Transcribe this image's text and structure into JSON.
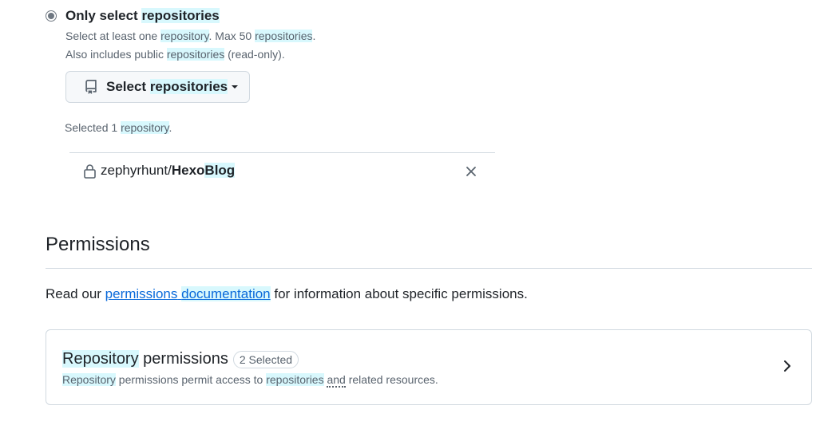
{
  "repository_access": {
    "option_label_pre": "Only select ",
    "option_label_hl": "repositories",
    "desc1": {
      "a": "Select at least one ",
      "b": "repository",
      "c": ". Max 50 ",
      "d": "repositories",
      "e": "."
    },
    "desc2": {
      "a": "Also includes public ",
      "b": "repositories",
      "c": " (read-only)."
    },
    "select_button": {
      "pre": "Select ",
      "hl": "repositories",
      "icon": "repo-icon"
    },
    "selected_count": {
      "a": "Selected 1 ",
      "b": "repository",
      "c": "."
    },
    "selected_repos": [
      {
        "owner": "zephyrhunt/",
        "name_a": "Hexo",
        "name_b": "Blog",
        "icon": "lock-icon"
      }
    ]
  },
  "permissions": {
    "title": "Permissions",
    "read": {
      "pre": "Read our ",
      "link_a": "permissions",
      "link_sp": " ",
      "link_b": "documentation",
      "post": " for information about specific permissions."
    },
    "repository_card": {
      "title_a": "Repository",
      "title_b": " permissions",
      "badge": "2 Selected",
      "desc": {
        "a": "Repository",
        "b": " permissions permit access to ",
        "c": "repositories",
        "d": " ",
        "e": "and",
        "f": " related resources."
      }
    }
  },
  "colors": {
    "highlight": "#d8f8fd",
    "link": "#0969da",
    "muted_text": "#59636e",
    "border": "#d1d9e0"
  }
}
